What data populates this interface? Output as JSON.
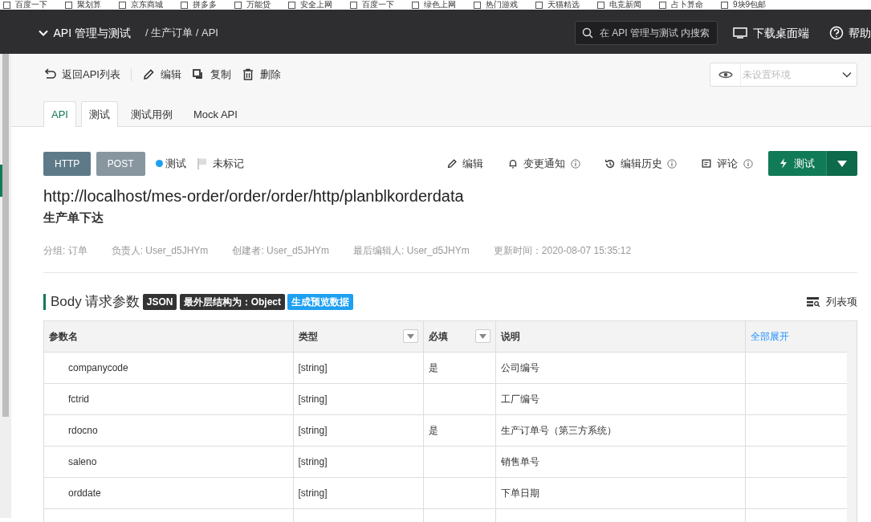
{
  "bookmarks": [
    "百度一下",
    "聚划算",
    "京东商城",
    "拼多多",
    "万能贷",
    "安全上网",
    "百度一下",
    "绿色上网",
    "热门游戏",
    "天猫精选",
    "电竞新闻",
    "占卜算命",
    "9块9包邮"
  ],
  "topbar": {
    "project": "API 管理与测试",
    "breadcrumb": "/ 生产订单 / API",
    "search": {
      "placeholder": "在 API 管理与测试 内搜索"
    },
    "download": "下载桌面端",
    "help": "帮助"
  },
  "toolbar": {
    "actions": [
      {
        "kind": "back",
        "label": "返回API列表"
      },
      {
        "kind": "edit",
        "label": "编辑"
      },
      {
        "kind": "copy",
        "label": "复制"
      },
      {
        "kind": "delete",
        "label": "删除"
      }
    ],
    "environment": {
      "placeholder": "未设置环境"
    }
  },
  "tabs": [
    {
      "label": "API",
      "selected": true,
      "outlined": true
    },
    {
      "label": "测试",
      "selected": false,
      "outlined": true
    },
    {
      "label": "测试用例",
      "selected": false,
      "outlined": false
    },
    {
      "label": "Mock API",
      "selected": false,
      "outlined": false
    }
  ],
  "api": {
    "protocol": "HTTP",
    "method": "POST",
    "status": {
      "label": "测试",
      "color": "#1e9ff2"
    },
    "flag": "未标记",
    "actions": [
      {
        "kind": "edit",
        "label": "编辑",
        "info": false
      },
      {
        "kind": "bell",
        "label": "变更通知",
        "info": true
      },
      {
        "kind": "history",
        "label": "编辑历史",
        "info": true
      },
      {
        "kind": "comment",
        "label": "评论",
        "info": true
      }
    ],
    "run_button": "测试",
    "url": "http://localhost/mes-order/order/order/http/planblkorderdata",
    "name": "生产单下达",
    "meta": [
      "分组: 订单",
      "负责人: User_d5JHYm",
      "创建者: User_d5JHYm",
      "最后编辑人: User_d5JHYm",
      "更新时间：2020-08-07 15:35:12"
    ]
  },
  "body": {
    "title": "Body 请求参数",
    "tags": [
      {
        "label": "JSON",
        "color": "#333333"
      },
      {
        "label": "最外层结构为：Object",
        "color": "#333333"
      },
      {
        "label": "生成预览数据",
        "color": "#1e9ff2"
      }
    ],
    "view_toggle": "列表项"
  },
  "table": {
    "columns": [
      {
        "label": "参数名",
        "filter": false
      },
      {
        "label": "类型",
        "filter": true
      },
      {
        "label": "必填",
        "filter": true
      },
      {
        "label": "说明",
        "filter": false
      }
    ],
    "expand_all": "全部展开",
    "rows": [
      [
        "companycode",
        "[string]",
        "是",
        "公司编号"
      ],
      [
        "fctrid",
        "[string]",
        "",
        "工厂编号"
      ],
      [
        "rdocno",
        "[string]",
        "是",
        "生产订单号（第三方系统）"
      ],
      [
        "saleno",
        "[string]",
        "",
        "销售单号"
      ],
      [
        "orddate",
        "[string]",
        "",
        "下单日期"
      ]
    ]
  }
}
